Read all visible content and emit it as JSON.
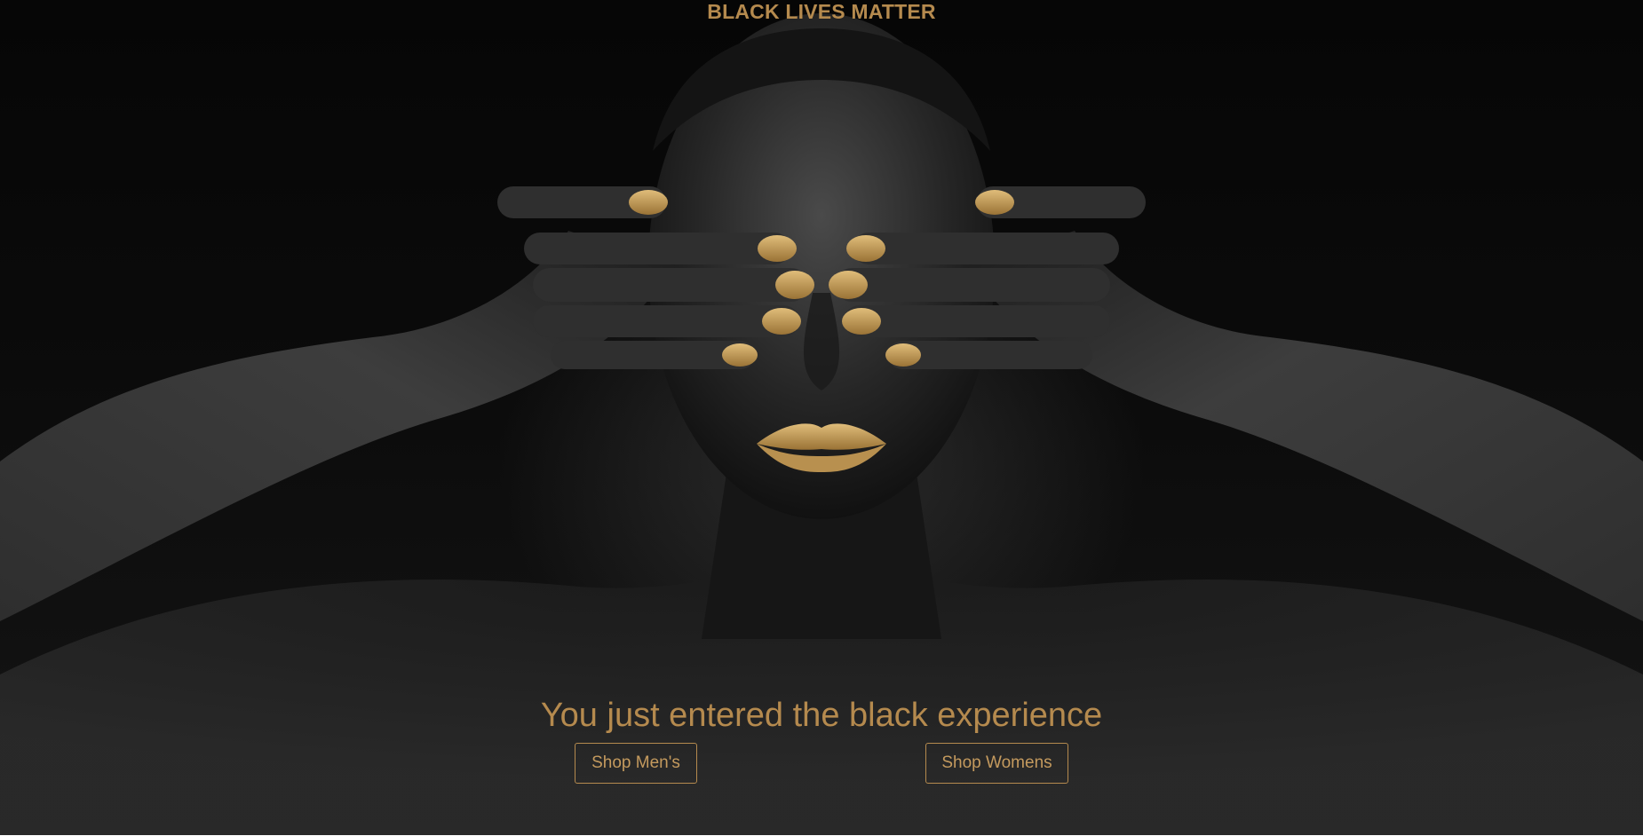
{
  "header": {
    "title": "BLACK LIVES MATTER"
  },
  "hero": {
    "image_subject": "woman with gold-painted fingertips and lips covering her eyes",
    "headline": "You just entered the black experience",
    "buttons": {
      "shop_mens": "Shop Men's",
      "shop_womens": "Shop Womens"
    }
  },
  "colors": {
    "accent_gold": "#b58a4e",
    "background": "#0a0a0a"
  }
}
